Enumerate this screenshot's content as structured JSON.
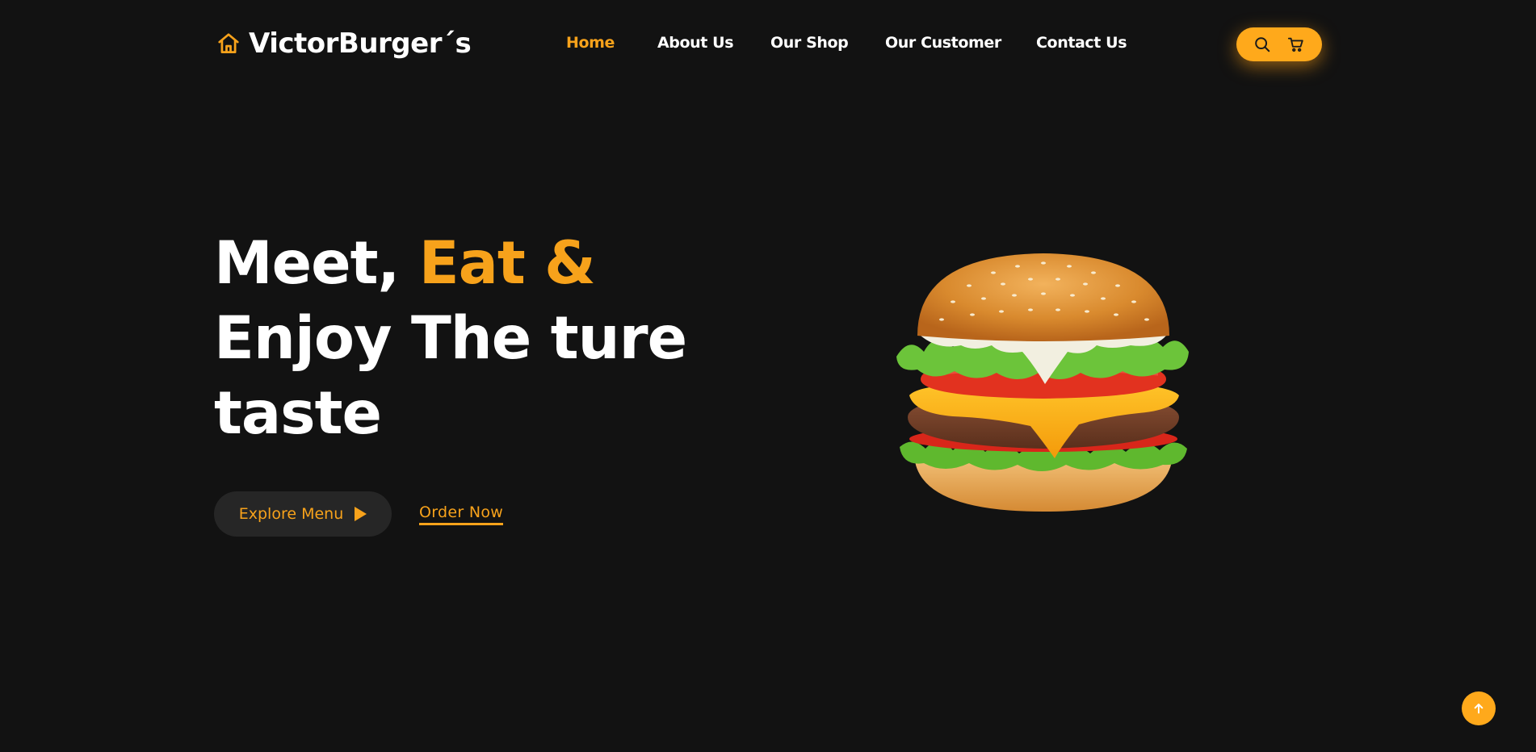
{
  "brand": {
    "name": "VictorBurger´s",
    "icon": "home-icon"
  },
  "nav": {
    "items": [
      {
        "label": "Home",
        "active": true
      },
      {
        "label": "About Us",
        "active": false
      },
      {
        "label": "Our Shop",
        "active": false
      },
      {
        "label": "Our Customer",
        "active": false
      },
      {
        "label": "Contact Us",
        "active": false
      }
    ]
  },
  "header_actions": {
    "icons": [
      "search-icon",
      "cart-icon"
    ]
  },
  "hero": {
    "title_part1": "Meet, ",
    "title_accent": "Eat &",
    "title_line2": "Enjoy The ture",
    "title_line3": "taste",
    "explore_label": "Explore Menu",
    "order_label": "Order Now",
    "image": "burger-image"
  },
  "scroll_top": {
    "icon": "arrow-up-icon"
  },
  "colors": {
    "background": "#121212",
    "accent": "#f7a21b",
    "pill": "#ffa91b",
    "button_dark": "#262626",
    "text": "#ffffff"
  }
}
